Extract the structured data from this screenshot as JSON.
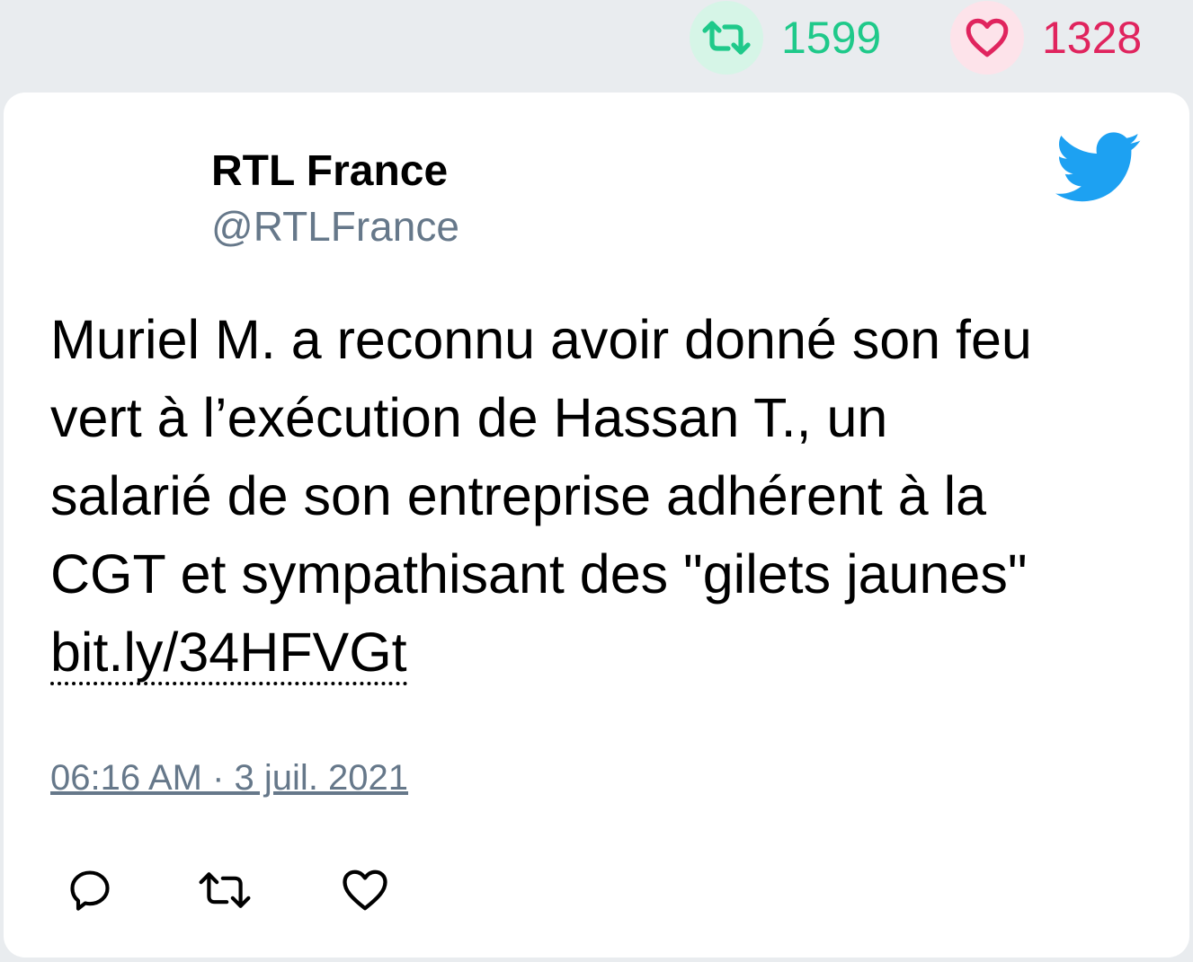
{
  "stats": {
    "retweets": {
      "count": "1599",
      "icon": "retweet-icon",
      "color": "#1fc98a"
    },
    "likes": {
      "count": "1328",
      "icon": "heart-icon",
      "color": "#e0245e"
    }
  },
  "tweet": {
    "author": {
      "name": "RTL France",
      "handle": "@RTLFrance"
    },
    "brand_icon": "twitter-bird-icon",
    "brand_color": "#1da1f2",
    "text_lines": [
      "Muriel M. a reconnu avoir donné son feu",
      "vert à l’exécution de Hassan T., un",
      "salarié de son entreprise adhérent à la",
      "CGT et sympathisant des \"gilets jaunes\""
    ],
    "link": "bit.ly/34HFVGt",
    "timestamp": "06:16 AM · 3 juil. 2021",
    "actions": {
      "reply_icon": "reply-icon",
      "retweet_icon": "retweet-icon",
      "like_icon": "heart-icon"
    }
  }
}
